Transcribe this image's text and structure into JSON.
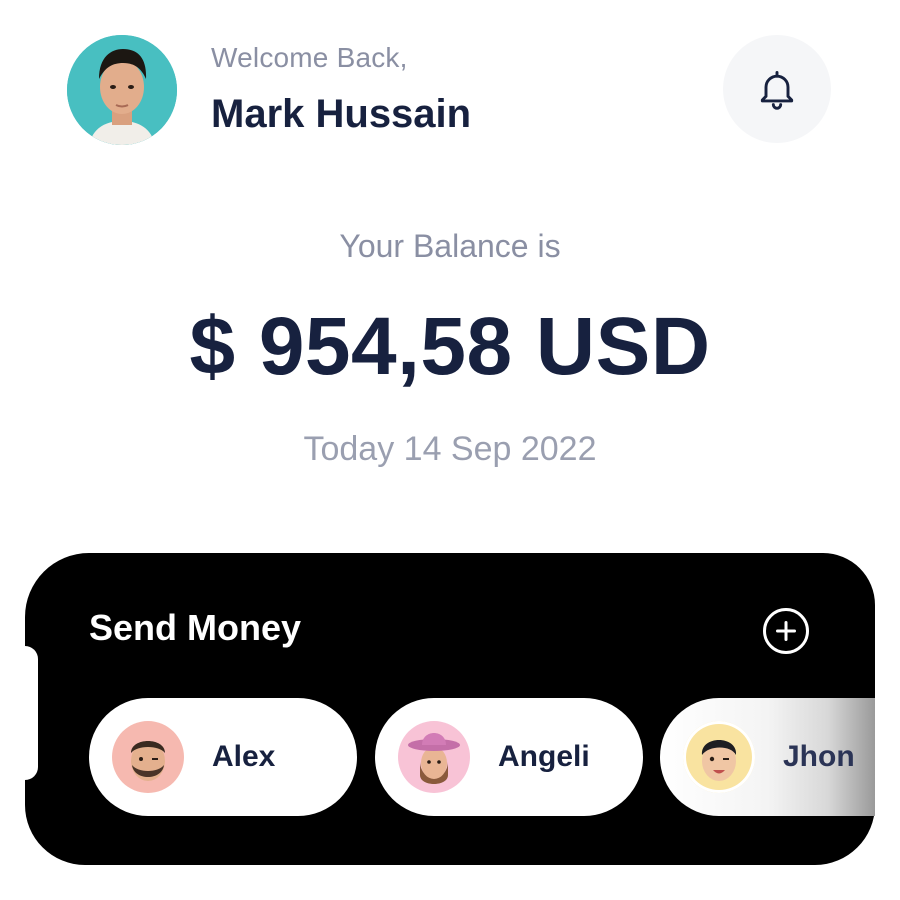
{
  "header": {
    "greeting": "Welcome Back,",
    "user_name": "Mark Hussain",
    "avatar_icon": "user-avatar-photo",
    "notification_icon": "bell-icon"
  },
  "balance": {
    "label": "Your Balance is",
    "amount": "$ 954,58 USD",
    "date": "Today 14 Sep 2022"
  },
  "send_money": {
    "title": "Send Money",
    "add_icon": "plus-circle-icon",
    "contacts": [
      {
        "name": "Alex",
        "avatar_color": "#f6b9b0"
      },
      {
        "name": "Angeli",
        "avatar_color": "#f8c3d6"
      },
      {
        "name": "Jhon",
        "avatar_color": "#f9e3a0"
      }
    ]
  },
  "colors": {
    "primary_text": "#17213f",
    "secondary_text": "#8a8fa3",
    "card_background": "#000000"
  }
}
